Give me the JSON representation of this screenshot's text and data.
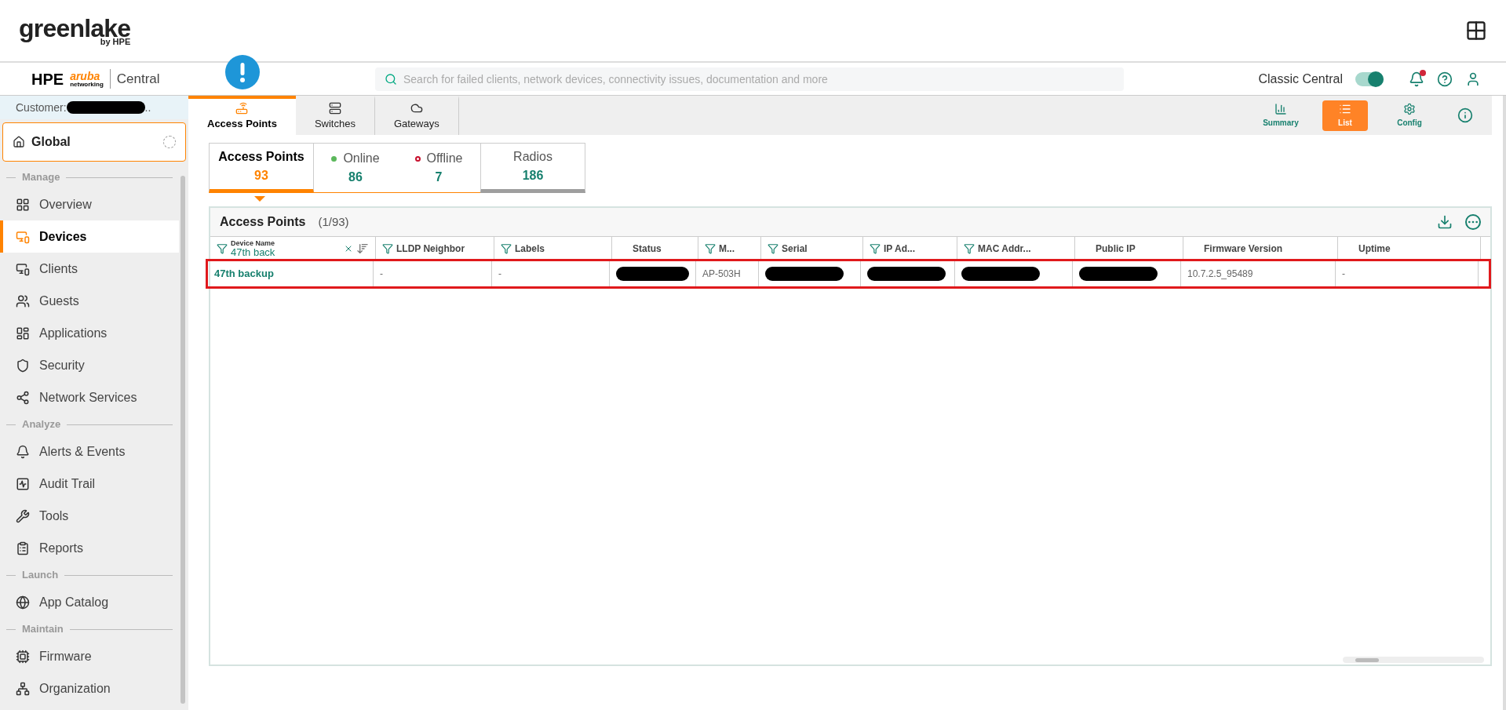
{
  "header": {
    "brand": "greenlake",
    "brand_sub": "by HPE"
  },
  "topbar": {
    "logo_main": "HPE",
    "logo_aruba": "aruba",
    "logo_networking": "networking",
    "product": "Central",
    "search": {
      "placeholder": "Search for failed clients, network devices, connectivity issues, documentation and more"
    },
    "classic_toggle": {
      "label": "Classic Central",
      "on": true
    },
    "notifications_unread": true
  },
  "sidebar": {
    "customer": {
      "label": "Customer:",
      "redacted": true,
      "suffix": ".."
    },
    "scope": "Global",
    "sections": [
      {
        "title": "Manage",
        "items": [
          {
            "label": "Overview",
            "selected": false
          },
          {
            "label": "Devices",
            "selected": true
          },
          {
            "label": "Clients",
            "selected": false
          },
          {
            "label": "Guests",
            "selected": false
          },
          {
            "label": "Applications",
            "selected": false
          },
          {
            "label": "Security",
            "selected": false
          },
          {
            "label": "Network Services",
            "selected": false
          }
        ]
      },
      {
        "title": "Analyze",
        "items": [
          {
            "label": "Alerts & Events",
            "selected": false
          },
          {
            "label": "Audit Trail",
            "selected": false
          },
          {
            "label": "Tools",
            "selected": false
          },
          {
            "label": "Reports",
            "selected": false
          }
        ]
      },
      {
        "title": "Launch",
        "items": [
          {
            "label": "App Catalog",
            "selected": false
          }
        ]
      },
      {
        "title": "Maintain",
        "items": [
          {
            "label": "Firmware",
            "selected": false
          },
          {
            "label": "Organization",
            "selected": false
          }
        ]
      }
    ]
  },
  "device_tabs": [
    {
      "label": "Access Points",
      "selected": true
    },
    {
      "label": "Switches",
      "selected": false
    },
    {
      "label": "Gateways",
      "selected": false
    }
  ],
  "view_buttons": [
    {
      "label": "Summary",
      "selected": false
    },
    {
      "label": "List",
      "selected": true
    },
    {
      "label": "Config",
      "selected": false
    }
  ],
  "summary_tiles": [
    {
      "kind": "total",
      "label": "Access Points",
      "count": "93",
      "selected": true
    },
    {
      "kind": "status",
      "label": "Online",
      "count": "86",
      "color": "#5cb85c"
    },
    {
      "kind": "status",
      "label": "Offline",
      "count": "7",
      "color": "#c8102e"
    },
    {
      "kind": "total",
      "label": "Radios",
      "count": "186",
      "selected": false
    }
  ],
  "table": {
    "title": "Access Points",
    "count": "(1/93)",
    "columns": [
      {
        "label": "Device Name",
        "filterable": true,
        "filter_value": "47th back"
      },
      {
        "label": "LLDP Neighbor",
        "filterable": true
      },
      {
        "label": "Labels",
        "filterable": true
      },
      {
        "label": "Status",
        "filterable": false
      },
      {
        "label": "M...",
        "filterable": true
      },
      {
        "label": "Serial",
        "filterable": true
      },
      {
        "label": "IP Ad...",
        "filterable": true
      },
      {
        "label": "MAC Addr...",
        "filterable": true
      },
      {
        "label": "Public IP",
        "filterable": false
      },
      {
        "label": "Firmware Version",
        "filterable": false
      },
      {
        "label": "Uptime",
        "filterable": false
      }
    ],
    "rows": [
      {
        "highlighted": true,
        "cells": [
          {
            "kind": "link",
            "text": "47th backup"
          },
          {
            "kind": "text",
            "text": "-"
          },
          {
            "kind": "text",
            "text": "-"
          },
          {
            "kind": "redacted"
          },
          {
            "kind": "text",
            "text": "AP-503H"
          },
          {
            "kind": "redacted"
          },
          {
            "kind": "redacted"
          },
          {
            "kind": "redacted"
          },
          {
            "kind": "redacted"
          },
          {
            "kind": "text",
            "text": "10.7.2.5_95489"
          },
          {
            "kind": "text",
            "text": "-"
          }
        ]
      }
    ]
  }
}
